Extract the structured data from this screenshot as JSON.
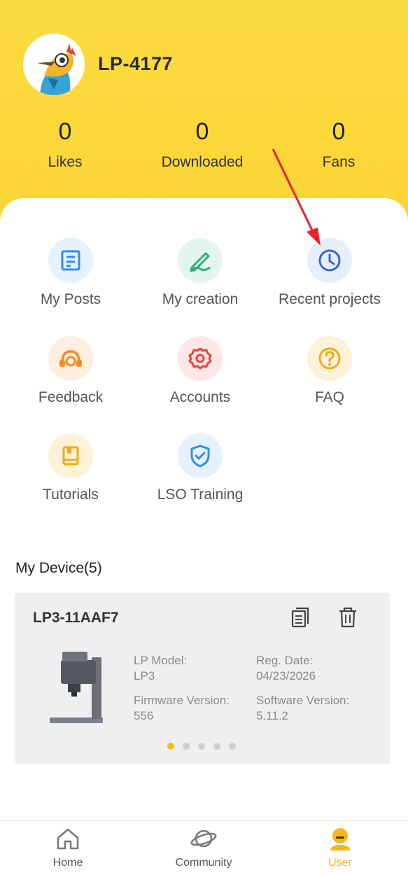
{
  "profile": {
    "username": "LP-4177",
    "stats": [
      {
        "value": "0",
        "label": "Likes"
      },
      {
        "value": "0",
        "label": "Downloaded"
      },
      {
        "value": "0",
        "label": "Fans"
      }
    ]
  },
  "menu": [
    {
      "label": "My Posts",
      "icon": "document-icon"
    },
    {
      "label": "My creation",
      "icon": "pen-icon"
    },
    {
      "label": "Recent projects",
      "icon": "clock-icon"
    },
    {
      "label": "Feedback",
      "icon": "headset-icon"
    },
    {
      "label": "Accounts",
      "icon": "gear-icon"
    },
    {
      "label": "FAQ",
      "icon": "question-icon"
    },
    {
      "label": "Tutorials",
      "icon": "book-icon"
    },
    {
      "label": "LSO Training",
      "icon": "shield-check-icon"
    }
  ],
  "devices": {
    "title": "My Device(5)",
    "current": {
      "name": "LP3-11AAF7",
      "model_label": "LP Model:",
      "model": "LP3",
      "reg_label": "Reg. Date:",
      "reg_date": "04/23/2026",
      "firmware_label": "Firmware Version:",
      "firmware": "556",
      "software_label": "Software Version:",
      "software": "5.11.2"
    },
    "page_count": 5,
    "active_page": 1
  },
  "tabbar": [
    {
      "label": "Home",
      "icon": "home-icon"
    },
    {
      "label": "Community",
      "icon": "planet-icon"
    },
    {
      "label": "User",
      "icon": "user-icon"
    }
  ],
  "colors": {
    "header_yellow": "#fcdc3f",
    "accent": "#f6b817",
    "annotation_arrow": "#e8232a"
  }
}
